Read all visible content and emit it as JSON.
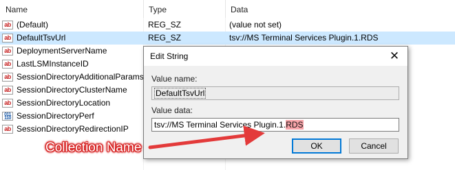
{
  "columns": {
    "name": "Name",
    "type": "Type",
    "data": "Data"
  },
  "rows": [
    {
      "icon": "ab",
      "name": "(Default)",
      "type": "REG_SZ",
      "data": "(value not set)"
    },
    {
      "icon": "ab",
      "name": "DefaultTsvUrl",
      "type": "REG_SZ",
      "data": "tsv://MS Terminal Services Plugin.1.RDS"
    },
    {
      "icon": "ab",
      "name": "DeploymentServerName",
      "type": "",
      "data": ""
    },
    {
      "icon": "ab",
      "name": "LastLSMInstanceID",
      "type": "",
      "data": ""
    },
    {
      "icon": "ab",
      "name": "SessionDirectoryAdditionalParams",
      "type": "",
      "data": ""
    },
    {
      "icon": "ab",
      "name": "SessionDirectoryClusterName",
      "type": "",
      "data": ""
    },
    {
      "icon": "ab",
      "name": "SessionDirectoryLocation",
      "type": "",
      "data": ""
    },
    {
      "icon": "011 110",
      "name": "SessionDirectoryPerf",
      "type": "",
      "data": ""
    },
    {
      "icon": "ab",
      "name": "SessionDirectoryRedirectionIP",
      "type": "",
      "data": ""
    }
  ],
  "dialog": {
    "title": "Edit String",
    "close_glyph": "✕",
    "value_name_label": "Value name:",
    "value_name": "DefaultTsvUrl",
    "value_data_label": "Value data:",
    "value_data_prefix": "tsv://MS Terminal Services Plugin.1.",
    "value_data_highlight": "RDS",
    "ok_label": "OK",
    "cancel_label": "Cancel"
  },
  "annotation": {
    "text": "Collection Name",
    "color": "#d62020"
  }
}
